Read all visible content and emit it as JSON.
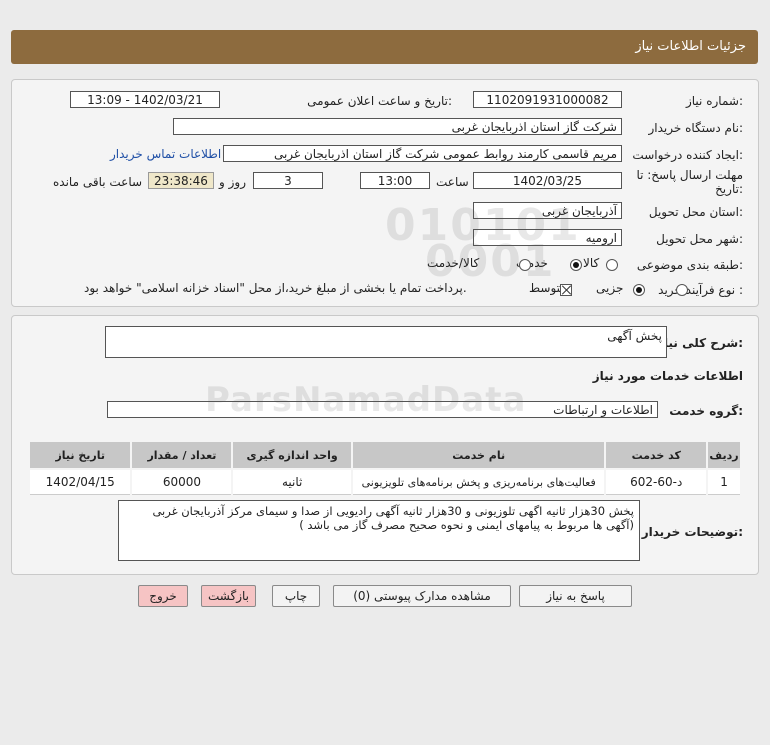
{
  "header": {
    "title": "جزئیات اطلاعات نیاز"
  },
  "details": {
    "need_number_label": "شماره نیاز:",
    "need_number": "1102091931000082",
    "announce_label": "تاریخ و ساعت اعلان عمومی:",
    "announce_value": "1402/03/21 - 13:09",
    "buyer_label": "نام دستگاه خریدار:",
    "buyer_value": "شرکت گاز استان اذربایجان غربی",
    "creator_label": "ایجاد کننده درخواست:",
    "creator_value": "مریم قاسمی کارمند روابط عمومی شرکت گاز استان اذربایجان غربی",
    "contact_link": "اطلاعات تماس خریدار",
    "deadline_label_line1": "مهلت ارسال پاسخ: تا",
    "deadline_label_line2": "تاریخ:",
    "deadline_date": "1402/03/25",
    "time_label": "ساعت",
    "deadline_time": "13:00",
    "days_value": "3",
    "days_label": "روز و",
    "remaining_time": "23:38:46",
    "remaining_label": "ساعت باقی مانده",
    "province_label": "استان محل تحویل:",
    "province_value": "آذربایجان غربی",
    "city_label": "شهر محل تحویل:",
    "city_value": "ارومیه",
    "category_label": "طبقه بندی موضوعی:",
    "category_options": [
      "کالا",
      "خدمت",
      "کالا/خدمت"
    ],
    "category_selected": "خدمت",
    "process_label": "نوع فرآیند خرید :",
    "process_options": [
      "جزیی",
      "متوسط"
    ],
    "process_selected": "متوسط",
    "payment_note": "پرداخت تمام یا بخشی از مبلغ خرید،از محل \"اسناد خزانه اسلامی\" خواهد بود.",
    "payment_checked": true
  },
  "summary": {
    "label": "شرح کلی نیاز:",
    "value": "پخش آگهی"
  },
  "services": {
    "section_title": "اطلاعات خدمات مورد نیاز",
    "group_label": "گروه خدمت:",
    "group_value": "اطلاعات و ارتباطات"
  },
  "table": {
    "headers": [
      "ردیف",
      "کد خدمت",
      "نام خدمت",
      "واحد اندازه گیری",
      "تعداد / مقدار",
      "تاریخ نیاز"
    ],
    "rows": [
      [
        "1",
        "د-60-602",
        "فعالیت‌های برنامه‌ریزی و پخش برنامه‌های تلویزیونی",
        "ثانیه",
        "60000",
        "1402/04/15"
      ]
    ]
  },
  "buyer_notes": {
    "label": "توضیحات خریدار:",
    "line1": "پخش 30هزار ثانیه اگهی تلوزیونی و 30هزار ثانیه آگهی رادیویی از صدا و سیمای مرکز آذربایجان غربی",
    "line2": "(آگهی ها مربوط به پیامهای ایمنی و نحوه صحیح مصرف گاز  می باشد )"
  },
  "buttons": {
    "reply": "پاسخ به نیاز",
    "attachments": "مشاهده مدارک پیوستی (0)",
    "print": "چاپ",
    "back": "بازگشت",
    "exit": "خروج"
  }
}
